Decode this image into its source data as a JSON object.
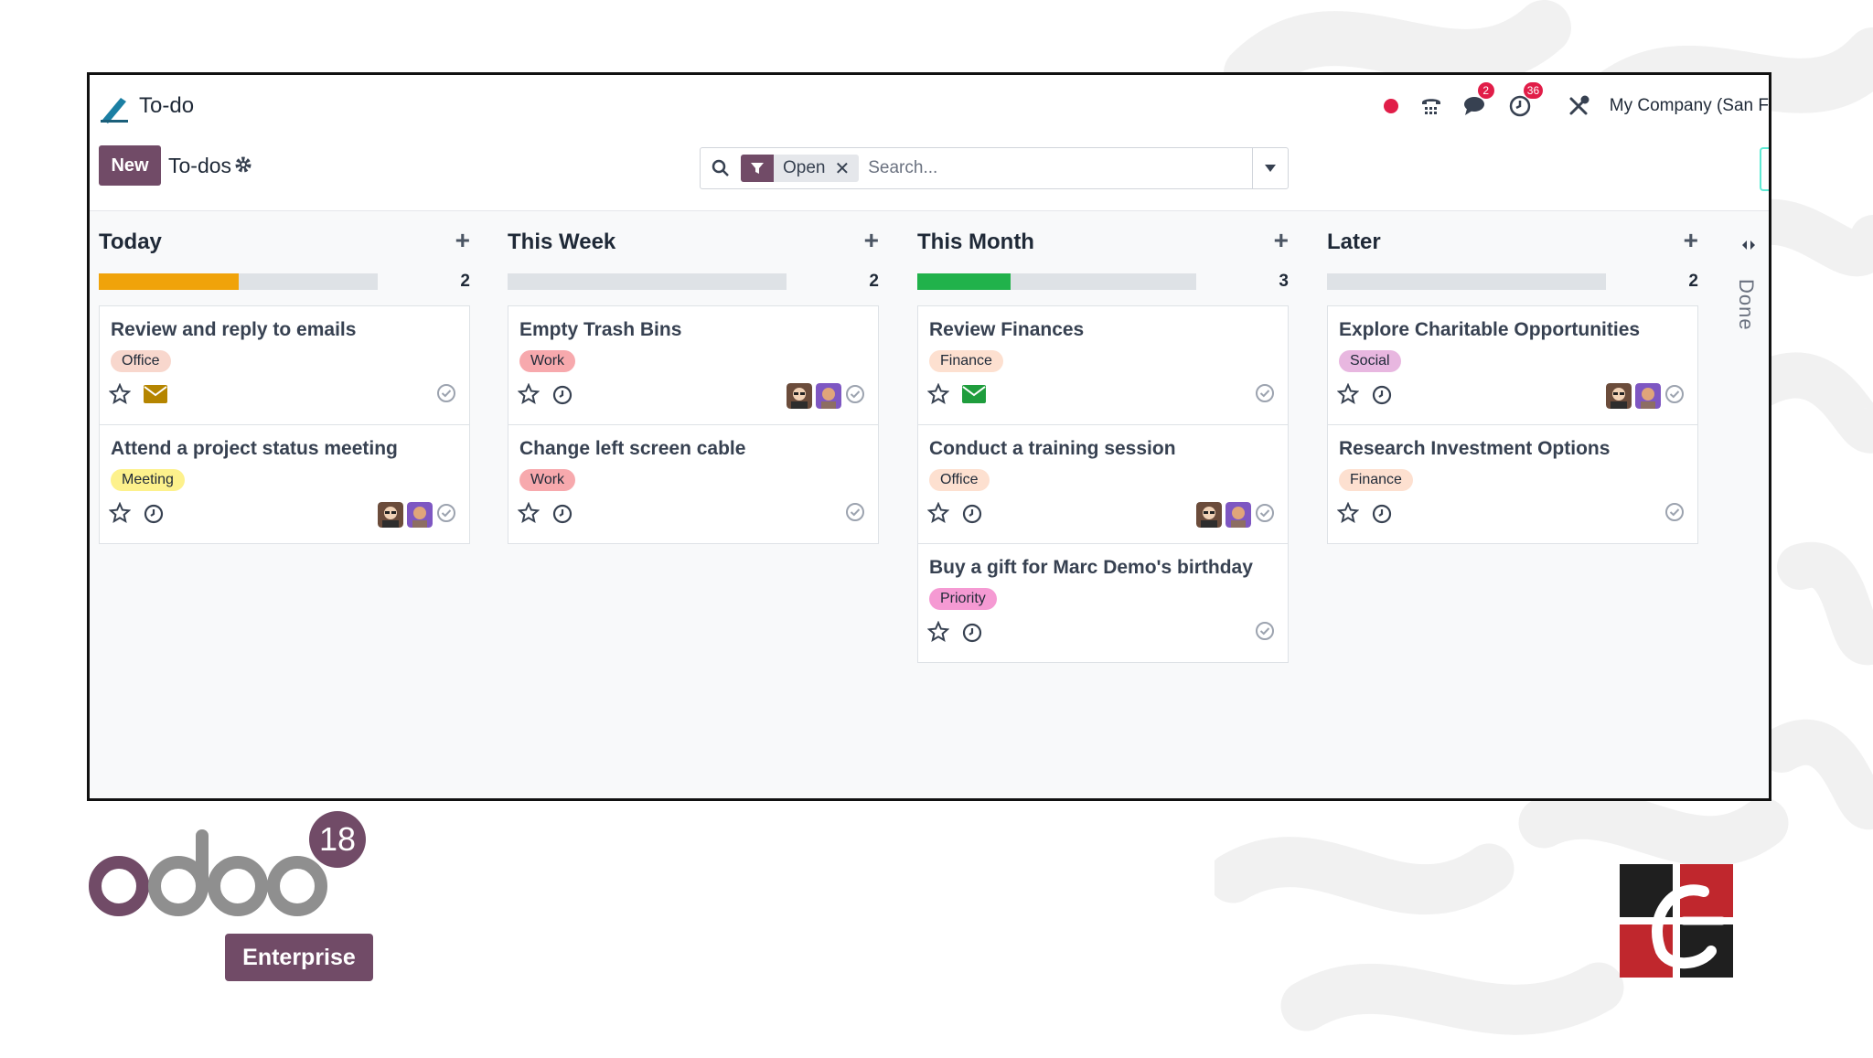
{
  "app": {
    "name": "To-do",
    "logo_icon": "todo-pen-icon",
    "accent": "#714b67"
  },
  "systray": {
    "recording_dot_color": "#e11d48",
    "phone_icon": "phone-icon",
    "messages_icon": "chat-icon",
    "messages_count": "2",
    "activities_icon": "clock-icon",
    "activities_count": "36",
    "tools_icon": "tools-icon",
    "company": "My Company (San F"
  },
  "controls": {
    "new_label": "New",
    "breadcrumb": "To-dos",
    "search": {
      "facet_value": "Open",
      "placeholder": "Search..."
    }
  },
  "columns": [
    {
      "title": "Today",
      "count": "2",
      "progress": 0.5,
      "progress_color": "#f0a30a",
      "cards": [
        {
          "title": "Review and reply to emails",
          "tag": "Office",
          "tag_color": "#f8d7cd",
          "activity": "envelope-icon",
          "activity_color": "#b58500",
          "avatars": 0
        },
        {
          "title": "Attend a project status meeting",
          "tag": "Meeting",
          "tag_color": "#fdf18c",
          "activity": "clock-icon",
          "activity_color": "#374151",
          "avatars": 2
        }
      ]
    },
    {
      "title": "This Week",
      "count": "2",
      "progress": 0,
      "progress_color": "#dee2e6",
      "cards": [
        {
          "title": "Empty Trash Bins",
          "tag": "Work",
          "tag_color": "#f7a9ad",
          "activity": "clock-icon",
          "activity_color": "#374151",
          "avatars": 2
        },
        {
          "title": "Change left screen cable",
          "tag": "Work",
          "tag_color": "#f7a9ad",
          "activity": "clock-icon",
          "activity_color": "#374151",
          "avatars": 0
        }
      ]
    },
    {
      "title": "This Month",
      "count": "3",
      "progress": 0.333,
      "progress_color": "#21b24b",
      "cards": [
        {
          "title": "Review Finances",
          "tag": "Finance",
          "tag_color": "#fde0d0",
          "activity": "envelope-icon",
          "activity_color": "#1f9d3d",
          "avatars": 0
        },
        {
          "title": "Conduct a training session",
          "tag": "Office",
          "tag_color": "#fde0d0",
          "activity": "clock-icon",
          "activity_color": "#374151",
          "avatars": 2
        },
        {
          "title": "Buy a gift for Marc Demo's birthday",
          "tag": "Priority",
          "tag_color": "#f59ad3",
          "activity": "clock-icon",
          "activity_color": "#374151",
          "avatars": 0
        }
      ]
    },
    {
      "title": "Later",
      "count": "2",
      "progress": 0,
      "progress_color": "#dee2e6",
      "cards": [
        {
          "title": "Explore Charitable Opportunities",
          "tag": "Social",
          "tag_color": "#e8b7e0",
          "activity": "clock-icon",
          "activity_color": "#374151",
          "avatars": 2
        },
        {
          "title": "Research Investment Options",
          "tag": "Finance",
          "tag_color": "#fde0d0",
          "activity": "clock-icon",
          "activity_color": "#374151",
          "avatars": 0
        }
      ]
    }
  ],
  "folded_column": {
    "label": "Done"
  },
  "branding": {
    "wordmark": "odoo",
    "version": "18",
    "edition": "Enterprise"
  }
}
